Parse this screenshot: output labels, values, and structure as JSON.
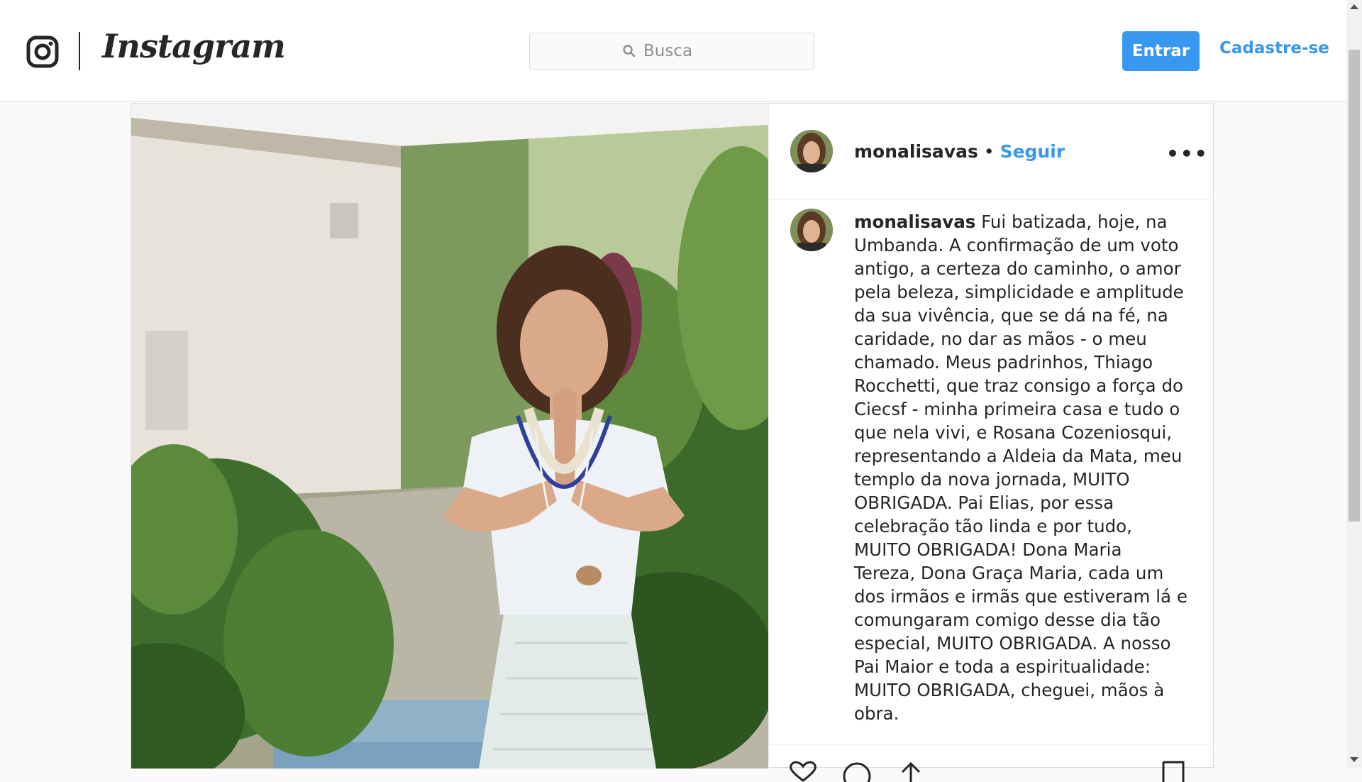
{
  "header": {
    "logo_icon": "instagram-camera-icon",
    "wordmark": "Instagram",
    "search": {
      "placeholder": "Busca",
      "value": "",
      "icon": "search-icon"
    },
    "login_label": "Entrar",
    "signup_label": "Cadastre-se"
  },
  "post": {
    "author": "monalisavas",
    "separator": "•",
    "follow_label": "Seguir",
    "more_icon": "more-options-icon",
    "more_label": "•••",
    "caption": {
      "author": "monalisavas",
      "text": "Fui batizada, hoje, na Umbanda. A confirmação de um voto antigo, a certeza do caminho, o amor pela beleza, simplicidade e amplitude da sua vivência, que se dá na fé, na caridade, no dar as mãos - o meu chamado. Meus padrinhos, Thiago Rocchetti, que traz consigo a força do Ciecsf - minha primeira casa e tudo o que nela vivi, e Rosana Cozeniosqui, representando a Aldeia da Mata, meu templo da nova jornada, MUITO OBRIGADA. Pai Elias, por essa celebração tão linda e por tudo, MUITO OBRIGADA! Dona Maria Tereza, Dona Graça Maria, cada um dos irmãos e irmãs que estiveram lá e comungaram comigo desse dia tão especial, MUITO OBRIGADA. A nosso Pai Maior e toda a espiritualidade: MUITO OBRIGADA, cheguei, mãos à obra."
    },
    "action_icons": [
      "heart-icon",
      "comment-icon",
      "share-icon",
      "save-icon"
    ]
  },
  "colors": {
    "accent": "#3897f0",
    "text": "#262626",
    "border": "#dbdbdb",
    "page_bg": "#fafafa"
  }
}
